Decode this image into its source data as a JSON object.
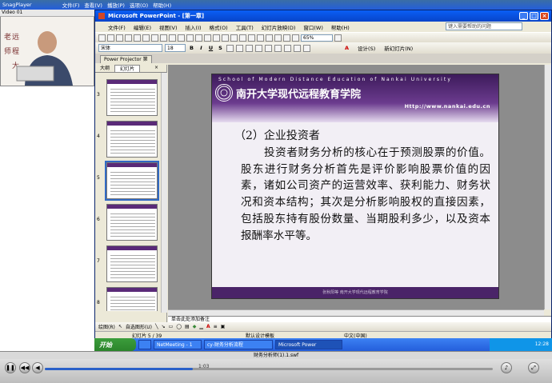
{
  "player": {
    "title": "SnagPlayer",
    "menu": [
      "文件(F)",
      "查看(V)",
      "播放(P)",
      "选项(O)",
      "帮助(H)"
    ],
    "video_label": "Video 01",
    "file_name": "财务分析师(1).1.swf",
    "seek_time": "1:03",
    "progress_fraction": 0.33
  },
  "ppt": {
    "title": "Microsoft PowerPoint - [第一章]",
    "menu": [
      "文件(F)",
      "编辑(E)",
      "视图(V)",
      "插入(I)",
      "格式(O)",
      "工具(T)",
      "幻灯片放映(D)",
      "窗口(W)",
      "帮助(H)"
    ],
    "ask_placeholder": "键入需要帮助的问题",
    "zoom": "65%",
    "font_name": "宋体",
    "font_size": "18",
    "design_label": "设计(S)",
    "new_slide_label": "新幻灯片(N)",
    "doc_tab": "Power Projector 第",
    "pane_tabs": [
      "大纲",
      "幻灯片"
    ],
    "thumbs": [
      {
        "num": "3",
        "selected": false
      },
      {
        "num": "4",
        "selected": false
      },
      {
        "num": "5",
        "selected": true
      },
      {
        "num": "6",
        "selected": false
      },
      {
        "num": "7",
        "selected": false
      },
      {
        "num": "8",
        "selected": false
      }
    ],
    "notes_placeholder": "单击此处添加备注",
    "draw_label": "绘图(R)",
    "autoshape_label": "自选图形(U)",
    "status": {
      "slide": "幻灯片 5 / 39",
      "template": "默认设计模板",
      "lang": "中文(中国)"
    }
  },
  "slide": {
    "english_header": "School of Modern Distance Education of Nankai University",
    "brand": "南开大学现代远程教育学院",
    "url": "Http://www.nankai.edu.cn",
    "heading": "（2）企业投资者",
    "body": "投资者财务分析的核心在于预测股票的价值。股东进行财务分析首先是评价影响股票价值的因素，诸如公司资产的运营效率、获利能力、财务状况和资本结构；其次是分析影响股权的直接因素，包括股东持有股份数量、当期股利多少，以及资本报酬率水平等。",
    "footer": "张秋阳等  南开大学现代远程教育学院"
  },
  "taskbar": {
    "start": "开始",
    "tasks": [
      "NetMeeting - 1",
      "cy-财务分析流程",
      "Microsoft Power"
    ],
    "clock": "12:28"
  },
  "colors": {
    "slide_purple": "#4a2468",
    "xp_blue": "#245edb"
  }
}
